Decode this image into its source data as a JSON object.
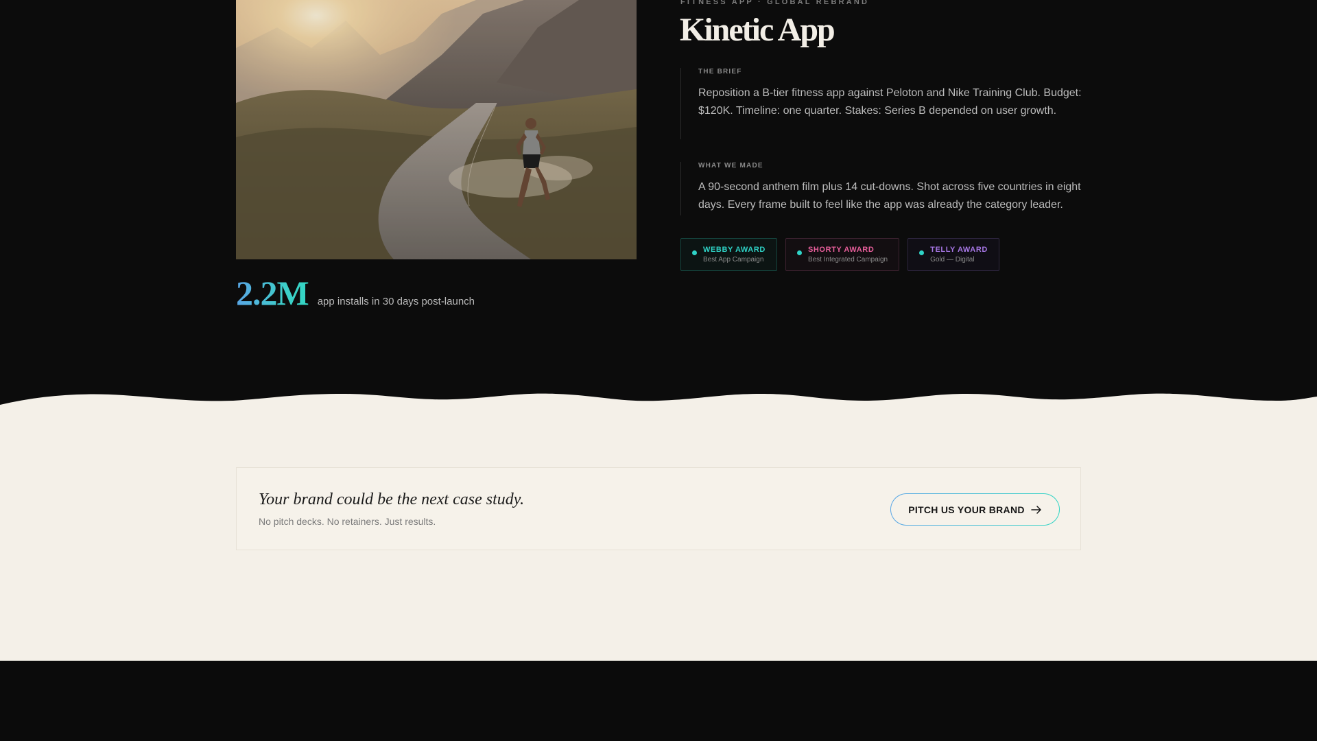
{
  "case": {
    "eyebrow": "FITNESS APP · GLOBAL REBRAND",
    "title": "Kinetic App",
    "brief_label": "THE BRIEF",
    "brief_text": "Reposition a B-tier fitness app against Peloton and Nike Training Club. Budget: $120K. Timeline: one quarter. Stakes: Series B depended on user growth.",
    "made_label": "WHAT WE MADE",
    "made_text": "A 90-second anthem film plus 14 cut-downs. Shot across five countries in eight days. Every frame built to feel like the app was already the category leader."
  },
  "stat": {
    "value": "2.2M",
    "label": "app installs in 30 days post-launch"
  },
  "awards": [
    {
      "name": "WEBBY AWARD",
      "sub": "Best App Campaign",
      "color": "#2fd3c7"
    },
    {
      "name": "SHORTY AWARD",
      "sub": "Best Integrated Campaign",
      "color": "#e95f9c"
    },
    {
      "name": "TELLY AWARD",
      "sub": "Gold — Digital",
      "color": "#a777e6"
    }
  ],
  "cta": {
    "title": "Your brand could be the next case study.",
    "subtitle": "No pitch decks. No retainers. Just results.",
    "button_label": "PITCH US YOUR BRAND",
    "button_icon": "arrow-right-icon"
  },
  "colors": {
    "accent_blue": "#5aa6e6",
    "accent_teal": "#33d6c4",
    "dark_bg": "#0c0c0c",
    "cream_bg": "#f4f0e8"
  }
}
